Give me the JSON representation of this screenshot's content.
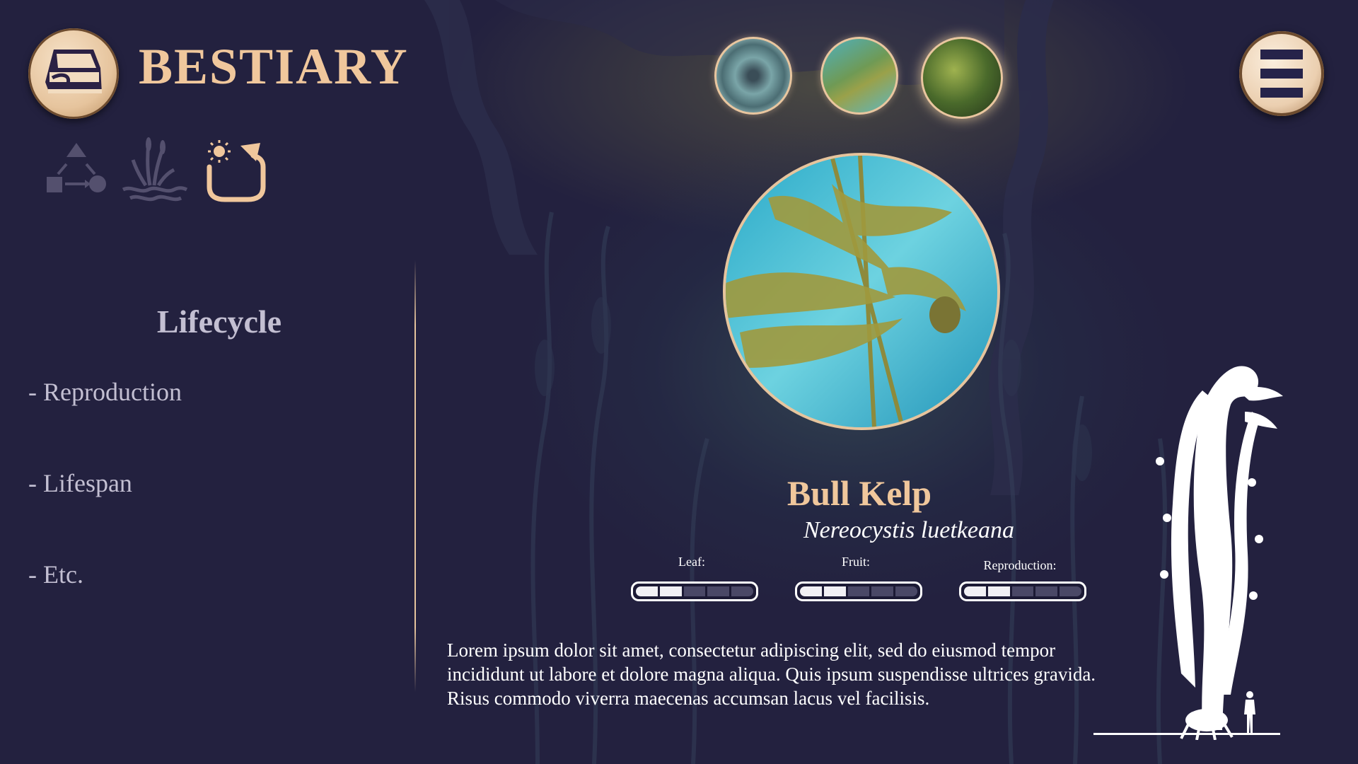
{
  "app": {
    "title": "BESTIARY",
    "logo_icon": "shoe-book-icon"
  },
  "categories": [
    {
      "name": "cycle-diagram-icon",
      "active": false
    },
    {
      "name": "plant-water-icon",
      "active": false
    },
    {
      "name": "lifecycle-icon",
      "active": true
    }
  ],
  "sidebar": {
    "title": "Lifecycle",
    "items": [
      "- Reproduction",
      "- Lifespan",
      "- Etc."
    ]
  },
  "thumbnails": [
    {
      "name": "sea-urchin",
      "selected": false
    },
    {
      "name": "bull-kelp",
      "selected": false
    },
    {
      "name": "green-algae",
      "selected": true
    }
  ],
  "species": {
    "common_name": "Bull Kelp",
    "latin_name": "Nereocystis luetkeana",
    "stats": [
      {
        "label": "Leaf:",
        "level": 2,
        "max": 5
      },
      {
        "label": "Fruit:",
        "level": 2,
        "max": 5
      },
      {
        "label": "Reproduction:",
        "level": 2,
        "max": 5
      }
    ],
    "description": "Lorem ipsum dolor sit amet, consectetur adipiscing elit, sed do eiusmod tempor incididunt ut labore et dolore magna aliqua. Quis ipsum suspendisse ultrices gravida. Risus commodo viverra maecenas accumsan lacus vel facilisis."
  },
  "colors": {
    "background": "#23213f",
    "accent": "#f0c79c",
    "text": "#ffffff",
    "muted": "#c3bfd2"
  }
}
